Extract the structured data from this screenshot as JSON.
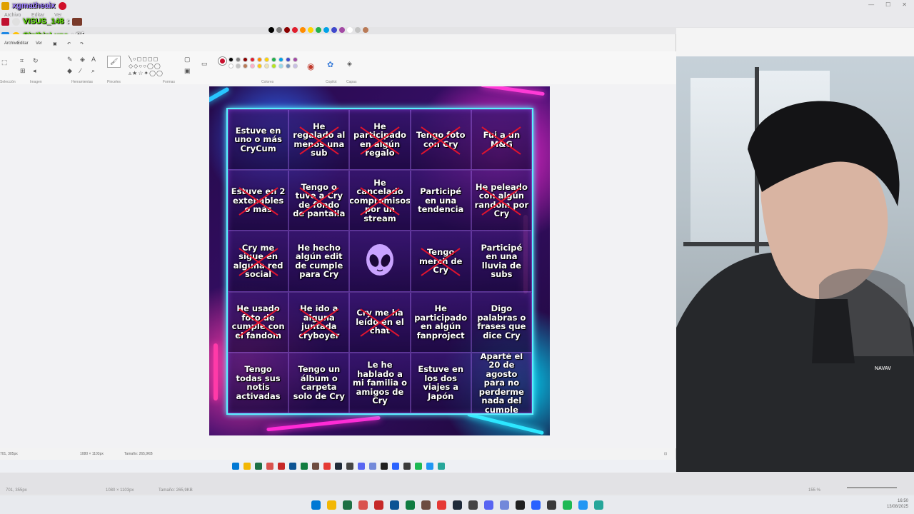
{
  "chat": [
    {
      "user": "xgmatheaix",
      "text": "",
      "color": "#7a5cff"
    },
    {
      "user": "VISUS_148",
      "text": ":",
      "color": "#55e000"
    },
    {
      "user": "CinthiaLuna",
      "text": ": Sí",
      "color": "#55e000"
    }
  ],
  "outer_menu": {
    "archivo": "Archivo",
    "editar": "Editar",
    "ver": "Ver"
  },
  "inner_menu": {
    "archivo": "Archivo",
    "editar": "Editar",
    "ver": "Ver"
  },
  "ribbon_groups": {
    "seleccion": "Selección",
    "imagen": "Imagen",
    "herramientas": "Herramientas",
    "pinceles": "Pinceles",
    "formas": "Formas",
    "colores": "Colores",
    "copilot": "Copilot",
    "capas": "Capas"
  },
  "palette": [
    "#000000",
    "#808080",
    "#8b0000",
    "#e01e2e",
    "#ff8c00",
    "#ffd400",
    "#22b14c",
    "#00a2e8",
    "#3f48cc",
    "#a349a4",
    "#ffffff",
    "#c3c3c3",
    "#b97a57",
    "#ffaec9",
    "#ffc90e",
    "#efe4b0",
    "#b5e61d",
    "#99d9ea",
    "#7092be",
    "#c8bfe7"
  ],
  "active_color": "#c8102e",
  "bingo": [
    {
      "text": "Estuve en uno o más CryCum",
      "crossed": false
    },
    {
      "text": "He regalado al menos una sub",
      "crossed": true
    },
    {
      "text": "He participado en algún regalo",
      "crossed": true
    },
    {
      "text": "Tengo foto con Cry",
      "crossed": true
    },
    {
      "text": "Fui a un M&G",
      "crossed": true
    },
    {
      "text": "Estuve en 2 extenables o más",
      "crossed": true
    },
    {
      "text": "Tengo o tuve a Cry de fondo de pantalla",
      "crossed": true
    },
    {
      "text": "He cancelado compromisos por un stream",
      "crossed": true
    },
    {
      "text": "Participé en una tendencia",
      "crossed": false
    },
    {
      "text": "He peleado con algún random por Cry",
      "crossed": true
    },
    {
      "text": "Cry me sigue en alguna red social",
      "crossed": true
    },
    {
      "text": "He hecho algún edit de cumple para Cry",
      "crossed": false
    },
    {
      "text": "",
      "crossed": false,
      "center": true
    },
    {
      "text": "Tengo merch de Cry",
      "crossed": true
    },
    {
      "text": "Participé en una lluvia de subs",
      "crossed": false
    },
    {
      "text": "He usado foto de cumple con el fandom",
      "crossed": true
    },
    {
      "text": "He ido a alguna juntada cryboyer",
      "crossed": true
    },
    {
      "text": "Cry me ha leído en el chat",
      "crossed": true
    },
    {
      "text": "He participado en algún fanproject",
      "crossed": false
    },
    {
      "text": "Digo palabras o frases que dice Cry",
      "crossed": false
    },
    {
      "text": "Tengo todas sus notis activadas",
      "crossed": false
    },
    {
      "text": "Tengo un álbum o carpeta solo de Cry",
      "crossed": false
    },
    {
      "text": "Le he hablado a mi familia o amigos de Cry",
      "crossed": false
    },
    {
      "text": "Estuve en los dos viajes a Japón",
      "crossed": false
    },
    {
      "text": "Aparté el 20 de agosto para no perderme nada del cumple",
      "crossed": false
    }
  ],
  "inner_status": {
    "cursor": "701, 305px",
    "size": "1080 × 1103px",
    "filesize": "Tamaño: 265,9KB"
  },
  "outer_status": {
    "cursor": "701, 355px",
    "size": "1080 × 1103px",
    "filesize": "Tamaño: 265,9KB",
    "zoom": "155 %"
  },
  "clock": {
    "time": "16:50",
    "date": "13/08/2025"
  },
  "hoodie_text": "NAVAV"
}
